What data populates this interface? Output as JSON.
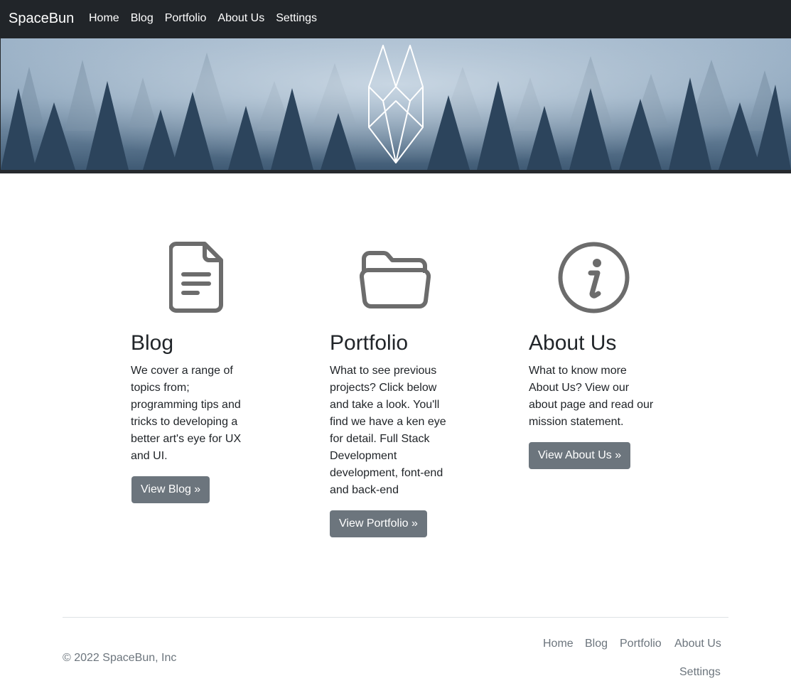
{
  "navbar": {
    "brand": "SpaceBun",
    "links": [
      "Home",
      "Blog",
      "Portfolio",
      "About Us",
      "Settings"
    ]
  },
  "features": [
    {
      "icon": "document-icon",
      "title": "Blog",
      "text_lines": [
        "We cover a range of",
        "topics from;",
        "programming tips and",
        "tricks to developing a",
        "better art's eye for UX",
        "and UI."
      ],
      "button": "View Blog »"
    },
    {
      "icon": "folder-icon",
      "title": "Portfolio",
      "text_lines": [
        "What to see previous",
        "projects? Click below",
        "and take a look. You'll",
        "find we have a ken eye",
        "for detail. Full Stack",
        "Development",
        "development, font-end",
        "and back-end"
      ],
      "button": "View Portfolio »"
    },
    {
      "icon": "info-icon",
      "title": "About Us",
      "text_lines": [
        "What to know more",
        "About Us? View our",
        "about page and read our",
        "mission statement."
      ],
      "button": "View About Us »"
    }
  ],
  "footer": {
    "copyright": "© 2022 SpaceBun, Inc",
    "links": [
      "Home",
      "Blog",
      "Portfolio",
      "About Us",
      "Settings"
    ]
  },
  "colors": {
    "navbar_bg": "#212529",
    "button_bg": "#6c757d",
    "icon_gray": "#6c6c6c",
    "muted_text": "#6c757d"
  }
}
